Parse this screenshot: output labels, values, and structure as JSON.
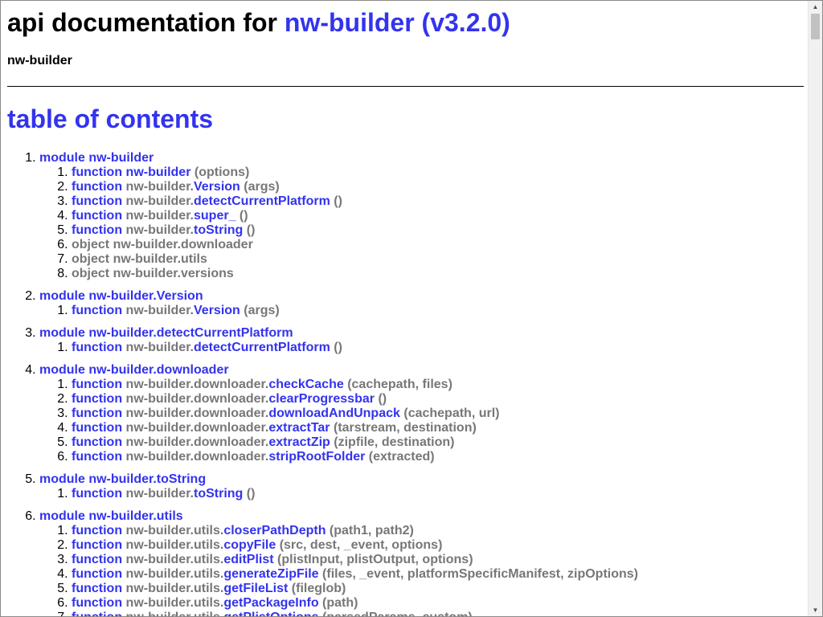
{
  "header": {
    "title_prefix": "api documentation for",
    "title_link": "nw-builder (v3.2.0)",
    "subtitle": "nw-builder"
  },
  "toc": {
    "heading": "table of contents",
    "modules": [
      {
        "label": "module nw-builder",
        "entries": [
          {
            "kind": "function",
            "ns": "nw-builder",
            "fn": "",
            "args": "(options)"
          },
          {
            "kind": "function",
            "ns": "nw-builder.",
            "fn": "Version",
            "args": "(args)"
          },
          {
            "kind": "function",
            "ns": "nw-builder.",
            "fn": "detectCurrentPlatform",
            "args": "()"
          },
          {
            "kind": "function",
            "ns": "nw-builder.",
            "fn": "super_",
            "args": "()"
          },
          {
            "kind": "function",
            "ns": "nw-builder.",
            "fn": "toString",
            "args": "()"
          },
          {
            "kind": "object",
            "text": "object nw-builder.downloader"
          },
          {
            "kind": "object",
            "text": "object nw-builder.utils"
          },
          {
            "kind": "object",
            "text": "object nw-builder.versions"
          }
        ]
      },
      {
        "label": "module nw-builder.Version",
        "entries": [
          {
            "kind": "function",
            "ns": "nw-builder.",
            "fn": "Version",
            "args": "(args)"
          }
        ]
      },
      {
        "label": "module nw-builder.detectCurrentPlatform",
        "entries": [
          {
            "kind": "function",
            "ns": "nw-builder.",
            "fn": "detectCurrentPlatform",
            "args": "()"
          }
        ]
      },
      {
        "label": "module nw-builder.downloader",
        "entries": [
          {
            "kind": "function",
            "ns": "nw-builder.downloader.",
            "fn": "checkCache",
            "args": "(cachepath, files)"
          },
          {
            "kind": "function",
            "ns": "nw-builder.downloader.",
            "fn": "clearProgressbar",
            "args": "()"
          },
          {
            "kind": "function",
            "ns": "nw-builder.downloader.",
            "fn": "downloadAndUnpack",
            "args": "(cachepath, url)"
          },
          {
            "kind": "function",
            "ns": "nw-builder.downloader.",
            "fn": "extractTar",
            "args": "(tarstream, destination)"
          },
          {
            "kind": "function",
            "ns": "nw-builder.downloader.",
            "fn": "extractZip",
            "args": "(zipfile, destination)"
          },
          {
            "kind": "function",
            "ns": "nw-builder.downloader.",
            "fn": "stripRootFolder",
            "args": "(extracted)"
          }
        ]
      },
      {
        "label": "module nw-builder.toString",
        "entries": [
          {
            "kind": "function",
            "ns": "nw-builder.",
            "fn": "toString",
            "args": "()"
          }
        ]
      },
      {
        "label": "module nw-builder.utils",
        "entries": [
          {
            "kind": "function",
            "ns": "nw-builder.utils.",
            "fn": "closerPathDepth",
            "args": "(path1, path2)"
          },
          {
            "kind": "function",
            "ns": "nw-builder.utils.",
            "fn": "copyFile",
            "args": "(src, dest, _event, options)"
          },
          {
            "kind": "function",
            "ns": "nw-builder.utils.",
            "fn": "editPlist",
            "args": "(plistInput, plistOutput, options)"
          },
          {
            "kind": "function",
            "ns": "nw-builder.utils.",
            "fn": "generateZipFile",
            "args": "(files, _event, platformSpecificManifest, zipOptions)"
          },
          {
            "kind": "function",
            "ns": "nw-builder.utils.",
            "fn": "getFileList",
            "args": "(fileglob)"
          },
          {
            "kind": "function",
            "ns": "nw-builder.utils.",
            "fn": "getPackageInfo",
            "args": "(path)"
          },
          {
            "kind": "function",
            "ns": "nw-builder.utils.",
            "fn": "getPlistOptions",
            "args": "(parsedParams, custom)"
          }
        ]
      }
    ]
  },
  "scrollbar": {
    "up_icon": "▲",
    "down_icon": "▼"
  }
}
